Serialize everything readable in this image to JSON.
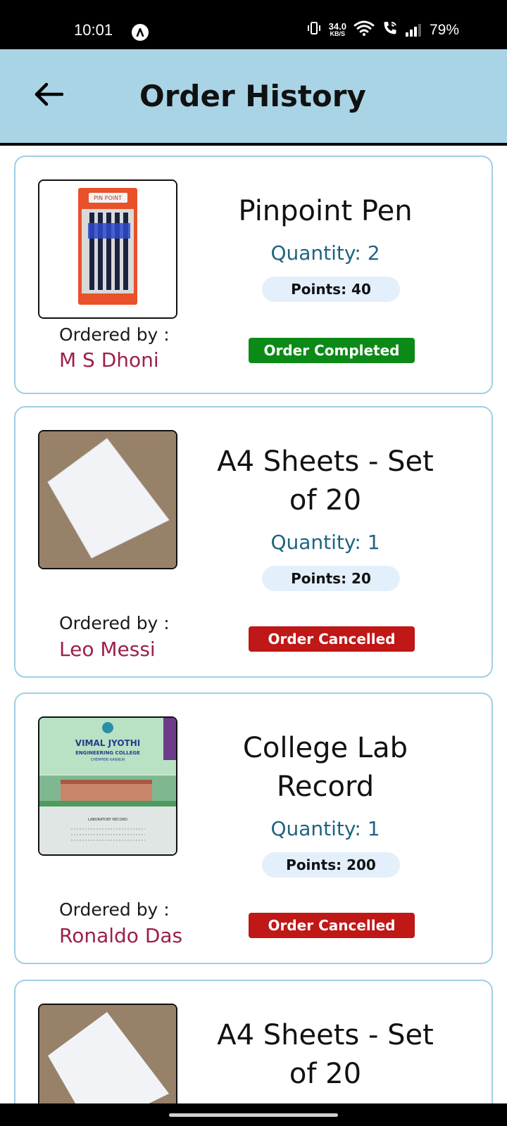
{
  "status_bar": {
    "time": "10:01",
    "net_speed_value": "34.0",
    "net_speed_unit": "KB/S",
    "battery": "79%"
  },
  "header": {
    "title": "Order History",
    "back_icon": "arrow-left-icon"
  },
  "orders": [
    {
      "product": "Pinpoint Pen",
      "quantity": "Quantity: 2",
      "points": "Points: 40",
      "ordered_by_label": "Ordered by :",
      "ordered_by": "M S Dhoni",
      "status": "Order Completed",
      "status_color": "#0c8a17",
      "image_brand": "PIN POINT"
    },
    {
      "product": "A4 Sheets - Set of 20",
      "quantity": "Quantity: 1",
      "points": "Points: 20",
      "ordered_by_label": "Ordered by :",
      "ordered_by": "Leo Messi",
      "status": "Order Cancelled",
      "status_color": "#c01717"
    },
    {
      "product": "College Lab Record",
      "quantity": "Quantity: 1",
      "points": "Points: 200",
      "ordered_by_label": "Ordered by :",
      "ordered_by": "Ronaldo Das",
      "status": "Order Cancelled",
      "status_color": "#c01717",
      "image_title": "VIMAL JYOTHI",
      "image_subtitle": "ENGINEERING COLLEGE",
      "image_place": "CHEMPERI KANNUR",
      "image_caption": "LABORATORY RECORD"
    },
    {
      "product": "A4 Sheets - Set of 20"
    }
  ],
  "colors": {
    "app_bar": "#a8d4e6",
    "card_border": "#9fcfe6",
    "name_color": "#9c1f4c",
    "quantity_color": "#1f6480",
    "points_bg": "#e3f0fb"
  }
}
